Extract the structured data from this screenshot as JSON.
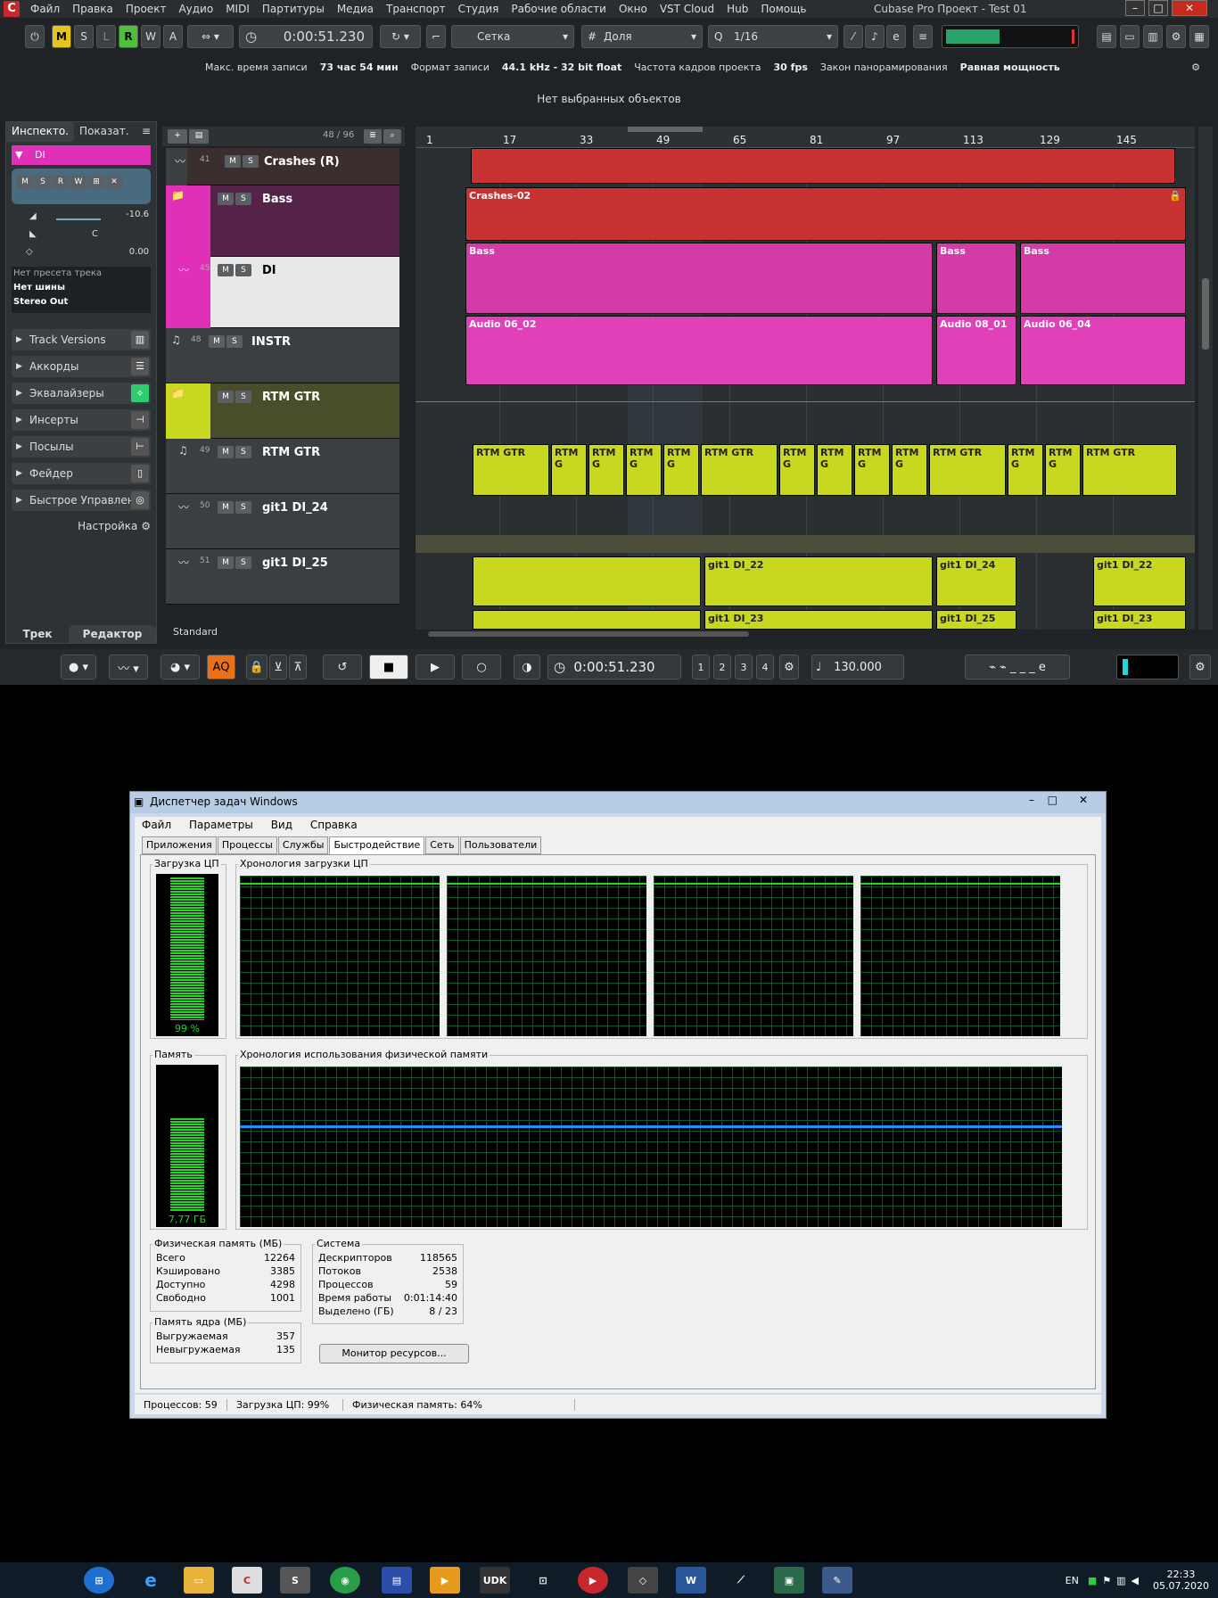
{
  "cubase": {
    "menu": [
      "Файл",
      "Правка",
      "Проект",
      "Аудио",
      "MIDI",
      "Партитуры",
      "Медиа",
      "Транспорт",
      "Студия",
      "Рабочие области",
      "Окно",
      "VST Cloud",
      "Hub",
      "Помощь"
    ],
    "title": "Cubase Pro Проект - Test 01",
    "toolbar": {
      "msr": [
        "M",
        "S",
        "L",
        "R",
        "W",
        "A"
      ],
      "time": "0:00:51.230",
      "snap_mode": "Сетка",
      "grid_type": "Доля",
      "quantize": "1/16"
    },
    "info": {
      "max_rec_label": "Макс. время записи",
      "max_rec_value": "73 час 54 мин",
      "format_label": "Формат записи",
      "format_value": "44.1 kHz - 32 bit float",
      "fps_label": "Частота кадров проекта",
      "fps_value": "30 fps",
      "pan_label": "Закон панорамирования",
      "pan_value": "Равная мощность"
    },
    "no_selection": "Нет выбранных объектов",
    "inspector": {
      "tab1": "Инспекто.",
      "tab2": "Показат.",
      "track_name": "DI",
      "volume": "-10.6",
      "pan": "C",
      "delay": "0.00",
      "preset": "Нет пресета трека",
      "bus": "Нет шины",
      "output": "Stereo Out",
      "sections": [
        "Track Versions",
        "Аккорды",
        "Эквалайзеры",
        "Инсерты",
        "Посылы",
        "Фейдер",
        "Быстрое Управление"
      ],
      "settings": "Настройка",
      "bottom_tab1": "Трек",
      "bottom_tab2": "Редактор"
    },
    "track_count": "48 / 96",
    "tracks": [
      {
        "num": "41",
        "name": "Crashes (R)",
        "color": "#c83232"
      },
      {
        "num": "",
        "name": "Bass",
        "color": "#e030b8"
      },
      {
        "num": "45",
        "name": "DI",
        "color": "#e030b8"
      },
      {
        "num": "48",
        "name": "INSTR",
        "color": "#9a9a9a"
      },
      {
        "num": "",
        "name": "RTM GTR",
        "color": "#c8d820"
      },
      {
        "num": "49",
        "name": "RTM GTR",
        "color": "#c8d820"
      },
      {
        "num": "50",
        "name": "git1 DI_24",
        "color": "#c8d820"
      },
      {
        "num": "51",
        "name": "git1 DI_25",
        "color": "#c8d820"
      }
    ],
    "track_footer": "Standard",
    "ruler": [
      "1",
      "17",
      "33",
      "49",
      "65",
      "81",
      "97",
      "113",
      "129",
      "145"
    ],
    "clips": {
      "crashes": "Crashes-02",
      "bass": [
        "Bass",
        "Bass",
        "Bass"
      ],
      "di": [
        "Audio 06_02",
        "Audio 08_01",
        "Audio 06_04"
      ],
      "rtm": [
        "RTM GTR",
        "RTM G",
        "RTM G",
        "RTM G",
        "RTM G",
        "RTM GTR",
        "RTM G",
        "RTM G",
        "RTM G",
        "RTM G",
        "RTM GTR",
        "RTM G",
        "RTM G",
        "RTM GTR"
      ],
      "git24": [
        "git1 DI_22",
        "git1 DI_24",
        "git1 DI_22"
      ],
      "git25": [
        "git1 DI_23",
        "git1 DI_25",
        "git1 DI_23"
      ]
    },
    "transport": {
      "time": "0:00:51.230",
      "tempo": "130.000",
      "aq": "AQ",
      "markers": [
        "1",
        "2",
        "3",
        "4"
      ]
    }
  },
  "taskmgr": {
    "title": "Диспетчер задач Windows",
    "menu": [
      "Файл",
      "Параметры",
      "Вид",
      "Справка"
    ],
    "tabs": [
      "Приложения",
      "Процессы",
      "Службы",
      "Быстродействие",
      "Сеть",
      "Пользователи"
    ],
    "cpu_label": "Загрузка ЦП",
    "cpu_value": "99 %",
    "cpu_percent": 99,
    "cpu_history_label": "Хронология загрузки ЦП",
    "mem_label": "Память",
    "mem_value": "7,77 ГБ",
    "mem_percent": 64,
    "mem_history_label": "Хронология использования физической памяти",
    "phys": {
      "title": "Физическая память (МБ)",
      "rows": [
        [
          "Всего",
          "12264"
        ],
        [
          "Кэшировано",
          "3385"
        ],
        [
          "Доступно",
          "4298"
        ],
        [
          "Свободно",
          "1001"
        ]
      ]
    },
    "kernel": {
      "title": "Память ядра (МБ)",
      "rows": [
        [
          "Выгружаемая",
          "357"
        ],
        [
          "Невыгружаемая",
          "135"
        ]
      ]
    },
    "system": {
      "title": "Система",
      "rows": [
        [
          "Дескрипторов",
          "118565"
        ],
        [
          "Потоков",
          "2538"
        ],
        [
          "Процессов",
          "59"
        ],
        [
          "Время работы",
          "0:01:14:40"
        ],
        [
          "Выделено (ГБ)",
          "8 / 23"
        ]
      ]
    },
    "monitor_button": "Монитор ресурсов...",
    "status": [
      "Процессов: 59",
      "Загрузка ЦП: 99%",
      "Физическая память: 64%"
    ]
  },
  "taskbar": {
    "lang": "EN",
    "time": "22:33",
    "date": "05.07.2020"
  }
}
